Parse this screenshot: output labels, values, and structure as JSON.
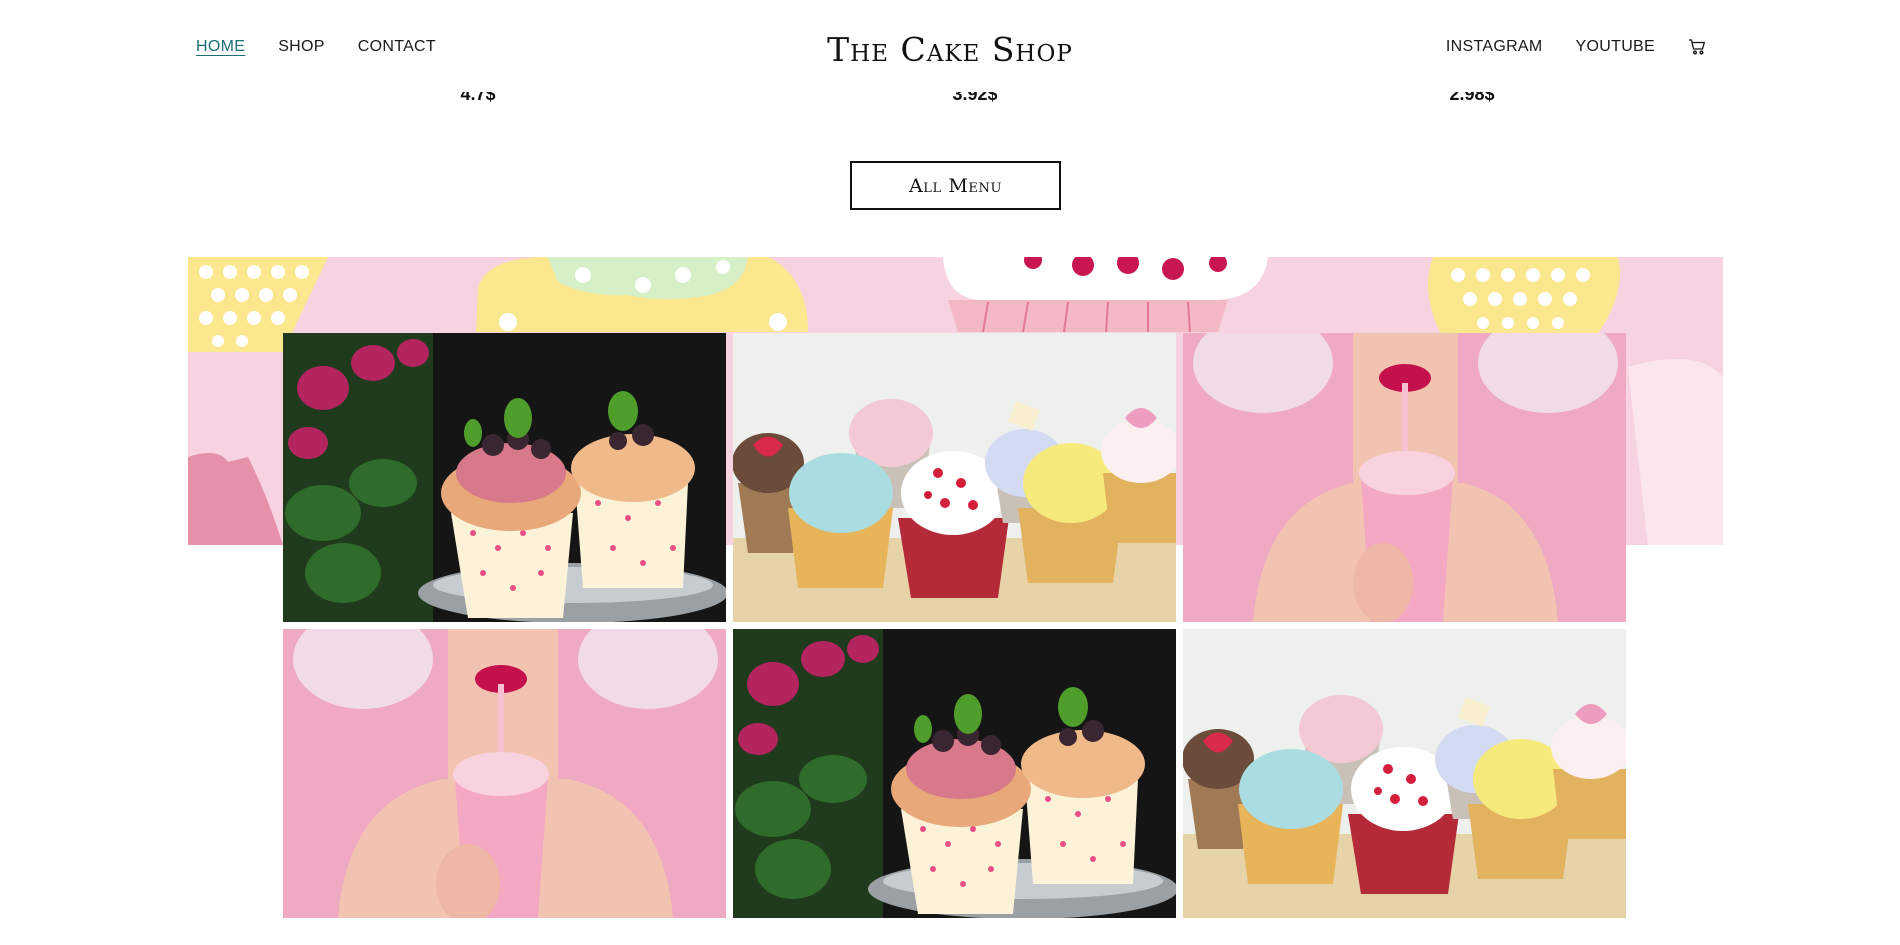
{
  "header": {
    "brand": "The Cake Shop",
    "nav_left": [
      {
        "label": "HOME",
        "active": true
      },
      {
        "label": "SHOP",
        "active": false
      },
      {
        "label": "CONTACT",
        "active": false
      }
    ],
    "nav_right": [
      {
        "label": "INSTAGRAM"
      },
      {
        "label": "YOUTUBE"
      }
    ],
    "cart_icon": "shopping-cart-icon"
  },
  "prices": [
    "4.7$",
    "3.92$",
    "2.98$"
  ],
  "all_menu_label": "All Menu",
  "colors": {
    "accent": "#1d6f73",
    "band_pink": "#f7d3e1",
    "text": "#111111"
  },
  "gallery": [
    {
      "subject": "berry-cupcakes-photo"
    },
    {
      "subject": "cupcake-lineup-photo"
    },
    {
      "subject": "pink-milkshake-portrait-photo"
    },
    {
      "subject": "pink-milkshake-portrait-photo"
    },
    {
      "subject": "berry-cupcakes-photo"
    },
    {
      "subject": "cupcake-lineup-photo"
    }
  ]
}
